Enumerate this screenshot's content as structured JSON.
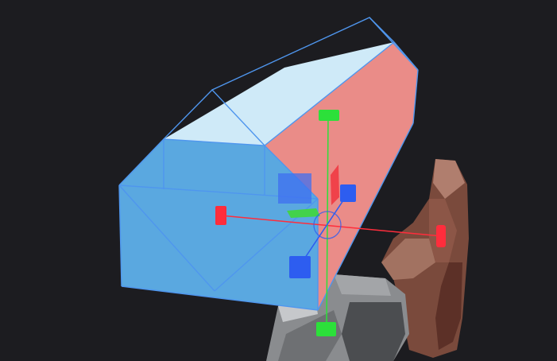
{
  "viewport": {
    "background": "#1c1c20",
    "selection_outline_color": "#4f96ee"
  },
  "selected_object": {
    "kind": "box-collider-volume",
    "faces": {
      "front": "#5aa8e0",
      "top": "#cfeaf8",
      "side": "#ea8c88"
    }
  },
  "transform_gizmo": {
    "mode": "scale",
    "axis_colors": {
      "x": "#ff2d3c",
      "y": "#2ce03a",
      "z": "#2d5df0"
    },
    "axis_handle_icons": {
      "x": "cube-handle-icon",
      "y": "cube-handle-icon",
      "z": "cube-handle-icon"
    },
    "plane_handle_colors": {
      "xy": "#3f6ff0",
      "xz": "#43d24a",
      "yz": "#f0424a"
    },
    "center_handle_icon": "circle-handle-icon"
  },
  "scene_model": {
    "kind": "background-mesh",
    "colors": {
      "wood": "#7a4a3c",
      "wood_light": "#a07060",
      "metal": "#8a8c8f",
      "metal_dark": "#4b4d50"
    }
  }
}
